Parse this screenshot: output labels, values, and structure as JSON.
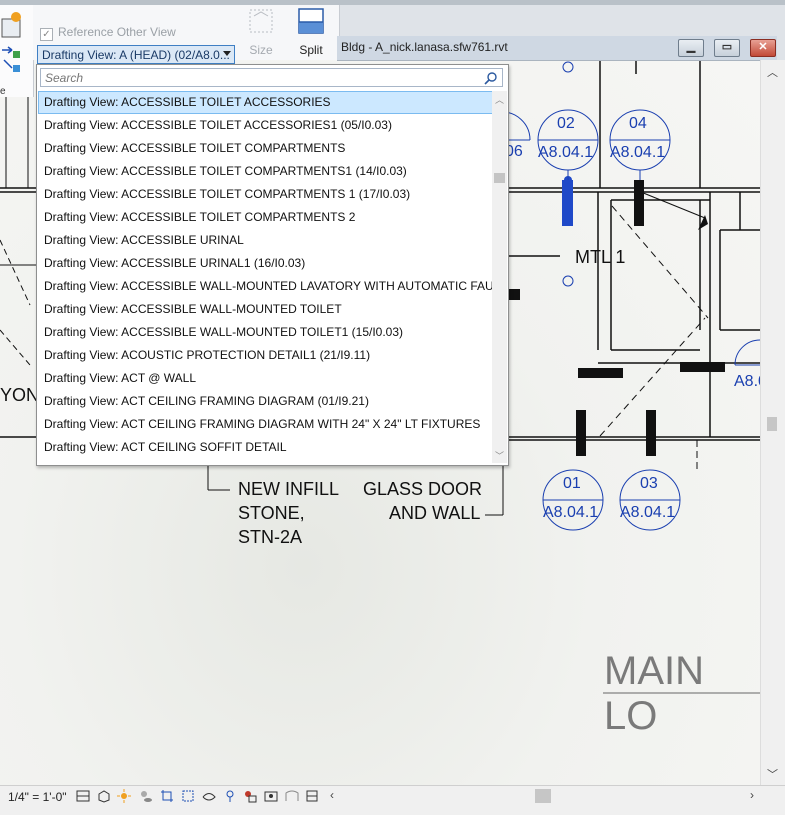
{
  "document": {
    "title": "Bldg - A_nick.lanasa.sfw761.rvt",
    "window_buttons": [
      "minimize",
      "restore",
      "close"
    ]
  },
  "ribbon": {
    "reference_other_view_label": "Reference Other View",
    "reference_other_view_checked": true,
    "view_select_value": "Drafting View: A (HEAD) (02/A8.0...",
    "size_label": "Size",
    "split_label": "Split"
  },
  "dropdown": {
    "search_placeholder": "Search",
    "selected_index": 0,
    "items": [
      "Drafting View: ACCESSIBLE TOILET ACCESSORIES",
      "Drafting View: ACCESSIBLE TOILET ACCESSORIES1 (05/I0.03)",
      "Drafting View: ACCESSIBLE TOILET COMPARTMENTS",
      "Drafting View: ACCESSIBLE TOILET COMPARTMENTS1 (14/I0.03)",
      "Drafting View: ACCESSIBLE TOILET COMPARTMENTS 1 (17/I0.03)",
      "Drafting View: ACCESSIBLE TOILET COMPARTMENTS 2",
      "Drafting View: ACCESSIBLE URINAL",
      "Drafting View: ACCESSIBLE URINAL1 (16/I0.03)",
      "Drafting View: ACCESSIBLE WALL-MOUNTED LAVATORY WITH AUTOMATIC FAUCET",
      "Drafting View: ACCESSIBLE WALL-MOUNTED TOILET",
      "Drafting View: ACCESSIBLE WALL-MOUNTED TOILET1 (15/I0.03)",
      "Drafting View: ACOUSTIC PROTECTION DETAIL1 (21/I9.11)",
      "Drafting View: ACT @ WALL",
      "Drafting View: ACT CEILING FRAMING DIAGRAM (01/I9.21)",
      "Drafting View: ACT CEILING FRAMING DIAGRAM WITH 24\" X 24\" LT FIXTURES",
      "Drafting View: ACT CEILING SOFFIT DETAIL"
    ]
  },
  "canvas": {
    "tags": [
      {
        "number": "06",
        "sheet": "A8.04.1"
      },
      {
        "number": "02",
        "sheet": "A8.04.1"
      },
      {
        "number": "04",
        "sheet": "A8.04.1"
      },
      {
        "number": "01",
        "sheet": "A8.04.1"
      },
      {
        "number": "03",
        "sheet": "A8.04.1"
      },
      {
        "number": "",
        "sheet": "A8.0"
      }
    ],
    "labels": {
      "mtl": "MTL 1",
      "yon": "YON",
      "new_infill_1": "NEW INFILL",
      "new_infill_2": "STONE,",
      "new_infill_3": "STN-2A",
      "glass_door_1": "GLASS DOOR",
      "glass_door_2": "AND WALL",
      "room_name": "MAIN LO"
    }
  },
  "statusbar": {
    "scale": "1/4\" = 1'-0\""
  },
  "colors": {
    "tag_blue": "#1a3fb0",
    "selection_blue": "#cce8ff",
    "dropdown_border": "#8e8f8f"
  }
}
